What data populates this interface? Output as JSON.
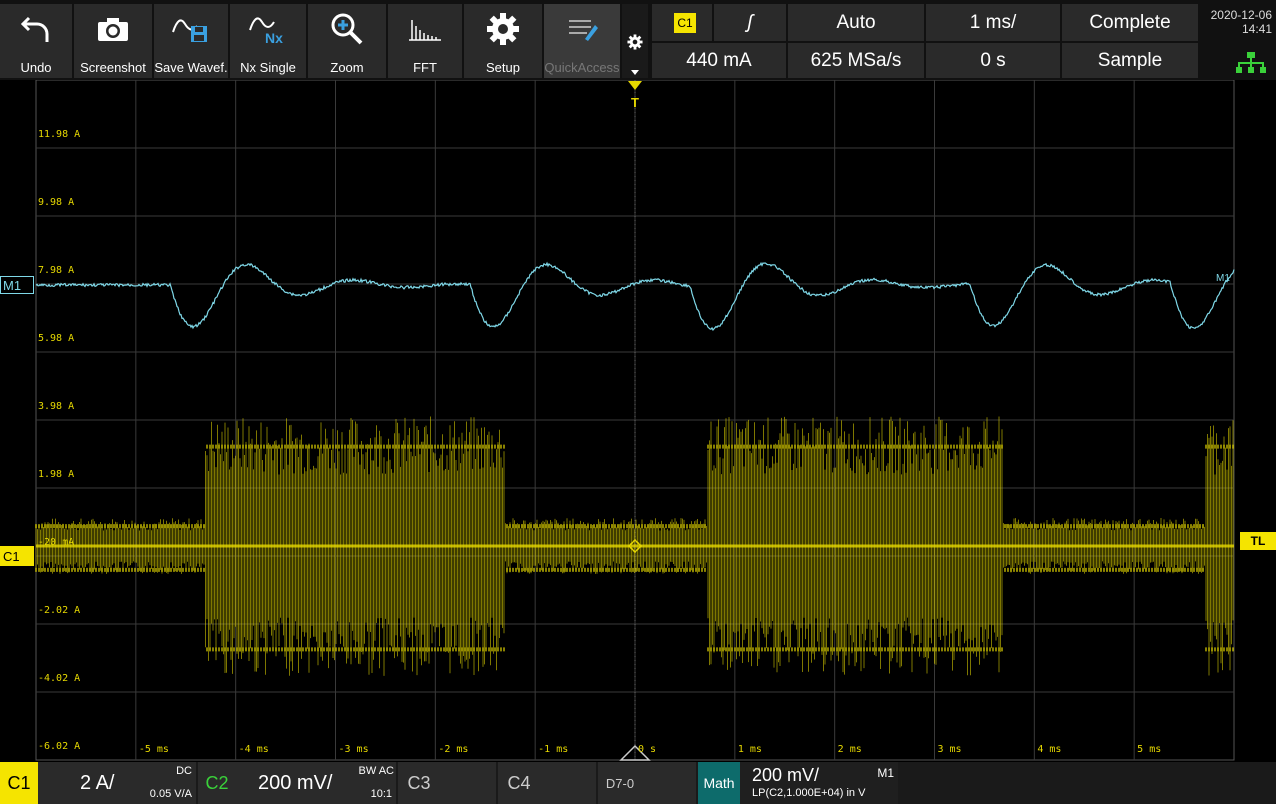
{
  "toolbar": {
    "buttons": [
      {
        "label": "Undo",
        "icon": "undo-icon"
      },
      {
        "label": "Screenshot",
        "icon": "camera-icon"
      },
      {
        "label": "Save Wavef.",
        "icon": "save-waveform-icon"
      },
      {
        "label": "Nx Single",
        "icon": "nx-single-icon",
        "icon_text": "Nx"
      },
      {
        "label": "Zoom",
        "icon": "zoom-icon"
      },
      {
        "label": "FFT",
        "icon": "fft-icon"
      },
      {
        "label": "Setup",
        "icon": "gear-icon"
      },
      {
        "label": "QuickAccess",
        "icon": "quick-access-icon"
      }
    ]
  },
  "status": {
    "trigger_source": "C1",
    "trigger_slope": "ʃ",
    "trigger_mode": "Auto",
    "timebase": "1 ms/",
    "acq_state": "Complete",
    "trigger_level": "440 mA",
    "sample_rate": "625 MSa/s",
    "horiz_position": "0 s",
    "acq_mode": "Sample",
    "date": "2020-12-06",
    "time": "14:41"
  },
  "scope": {
    "y_labels": [
      "11.98 A",
      "9.98 A",
      "7.98 A",
      "5.98 A",
      "3.98 A",
      "1.98 A",
      "-20 mA",
      "-2.02 A",
      "-4.02 A",
      "-6.02 A"
    ],
    "x_labels": [
      "-5 ms",
      "-4 ms",
      "-3 ms",
      "-2 ms",
      "-1 ms",
      "0 s",
      "1 ms",
      "2 ms",
      "3 ms",
      "4 ms",
      "5 ms"
    ],
    "m1_tag": "M1",
    "m1_right_label": "M1",
    "c1_tag": "C1",
    "trigger_marker": "T",
    "trigger_level_tag": "TL",
    "colors": {
      "c1": "#e6d800",
      "m1": "#7fd8e8",
      "grid": "#3a3a3a"
    }
  },
  "bottom": {
    "c1": {
      "label": "C1",
      "scale": "2 A/",
      "coupling": "DC",
      "factor": "0.05 V/A"
    },
    "c2": {
      "label": "C2",
      "scale": "200 mV/",
      "bw": "BW AC",
      "ratio": "10:1"
    },
    "c3": {
      "label": "C3"
    },
    "c4": {
      "label": "C4"
    },
    "digital": {
      "label": "D7-0"
    },
    "math": {
      "label": "Math",
      "scale": "200 mV/",
      "id": "M1",
      "expr": "LP(C2,1.000E+04) in V"
    }
  }
}
